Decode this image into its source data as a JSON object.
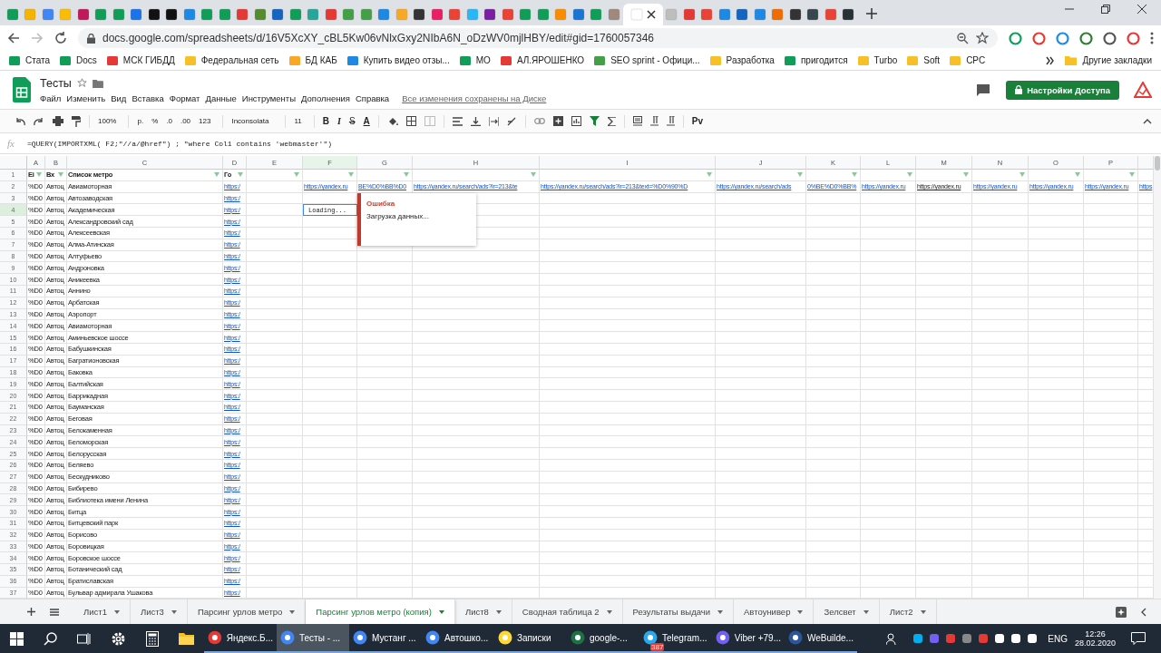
{
  "browser": {
    "url": "docs.google.com/spreadsheets/d/16V5XcXY_cBL5Kw06vNlxGxy2NIbA6N_oDzWV0mjlHBY/edit#gid=1760057346",
    "bookmarks": [
      {
        "label": "Стата"
      },
      {
        "label": "Docs"
      },
      {
        "label": "МСК ГИБДД"
      },
      {
        "label": "Федеральная сеть"
      },
      {
        "label": "БД КАБ"
      },
      {
        "label": "Купить видео отзы..."
      },
      {
        "label": "МО"
      },
      {
        "label": "АЛ.ЯРОШЕНКО"
      },
      {
        "label": "SEO sprint - Офици..."
      },
      {
        "label": "Разработка"
      },
      {
        "label": "пригодится"
      },
      {
        "label": "Turbo"
      },
      {
        "label": "Soft"
      },
      {
        "label": "CPC"
      }
    ],
    "other_bookmarks": "Другие закладки"
  },
  "doc": {
    "title": "Тесты",
    "menu": [
      "Файл",
      "Изменить",
      "Вид",
      "Вставка",
      "Формат",
      "Данные",
      "Инструменты",
      "Дополнения",
      "Справка"
    ],
    "saved_status": "Все изменения сохранены на Диске",
    "share_button": "Настройки Доступа"
  },
  "toolbar": {
    "zoom": "100%",
    "currency": "р.",
    "percent": "%",
    "dec_less": ".0",
    "dec_more": ".00",
    "number_format": "123",
    "font": "Inconsolata",
    "size": "11",
    "format_letters": [
      "B",
      "I",
      "S",
      "A"
    ],
    "input_tools": "Рv"
  },
  "formula": {
    "fx": "fx",
    "text": "=QUERY(IMPORTXML( F2;\"//a/@href\") ; \"where Col1 contains 'webmaster'\")"
  },
  "columns": [
    {
      "letter": "A",
      "header": "Ei",
      "selected": false
    },
    {
      "letter": "B",
      "header": "Вх",
      "selected": false
    },
    {
      "letter": "C",
      "header": "Список метро",
      "selected": false
    },
    {
      "letter": "D",
      "header": "Го",
      "selected": false
    },
    {
      "letter": "E",
      "selected": false
    },
    {
      "letter": "F",
      "selected": true
    },
    {
      "letter": "G",
      "selected": false
    },
    {
      "letter": "H",
      "selected": false
    },
    {
      "letter": "I",
      "selected": false
    },
    {
      "letter": "J",
      "selected": false
    },
    {
      "letter": "K",
      "selected": false
    },
    {
      "letter": "L",
      "selected": false
    },
    {
      "letter": "M",
      "selected": false
    },
    {
      "letter": "N",
      "selected": false
    },
    {
      "letter": "O",
      "selected": false
    },
    {
      "letter": "P",
      "selected": false
    }
  ],
  "header_row": "1",
  "rows": [
    {
      "n": "2",
      "a": "%D0",
      "b": "Автоц",
      "c": "Авиамоторная",
      "d": "https:/",
      "selected": false,
      "more": [
        {
          "kind": "empty"
        },
        {
          "kind": "link",
          "text": "https://yandex.ru"
        },
        {
          "kind": "link",
          "text": "BE%D0%BB%D0"
        },
        {
          "kind": "link",
          "text": "https://yandex.ru/search/ads?lr=213&te"
        },
        {
          "kind": "link",
          "text": "https://yandex.ru/search/ads?lr=213&text=%D0%90%D"
        },
        {
          "kind": "link",
          "text": "https://yandex.ru/search/ads"
        },
        {
          "kind": "link",
          "text": "0%BE%D0%BB%"
        },
        {
          "kind": "link",
          "text": "https://yandex.ru"
        },
        {
          "kind": "dark",
          "text": "https://yandex.ru"
        },
        {
          "kind": "link",
          "text": "https://yandex.ru"
        },
        {
          "kind": "link",
          "text": "https://yandex.ru"
        },
        {
          "kind": "link",
          "text": "https://yandex.ru"
        },
        {
          "kind": "link",
          "text": "https"
        }
      ]
    },
    {
      "n": "3",
      "a": "%D0",
      "b": "Автоц",
      "c": "Автозаводская",
      "d": "https:/",
      "selected": false
    },
    {
      "n": "4",
      "a": "%D0",
      "b": "Автоц",
      "c": "Академическая",
      "d": "https:/",
      "selected": true,
      "more": [
        {
          "kind": "empty"
        },
        {
          "kind": "loading",
          "text": "Loading..."
        }
      ]
    },
    {
      "n": "5",
      "a": "%D0",
      "b": "Автоц",
      "c": "Александровский сад",
      "d": "https:/",
      "selected": false
    },
    {
      "n": "6",
      "a": "%D0",
      "b": "Автоц",
      "c": "Алексеевская",
      "d": "https:/",
      "selected": false
    },
    {
      "n": "7",
      "a": "%D0",
      "b": "Автоц",
      "c": "Алма-Атинская",
      "d": "https:/",
      "selected": false
    },
    {
      "n": "8",
      "a": "%D0",
      "b": "Автоц",
      "c": "Алтуфьево",
      "d": "https:/",
      "selected": false
    },
    {
      "n": "9",
      "a": "%D0",
      "b": "Автоц",
      "c": "Андроновка",
      "d": "https:/",
      "selected": false
    },
    {
      "n": "10",
      "a": "%D0",
      "b": "Автоц",
      "c": "Аникеевка",
      "d": "https:/",
      "selected": false
    },
    {
      "n": "11",
      "a": "%D0",
      "b": "Автоц",
      "c": "Аннино",
      "d": "https:/",
      "selected": false
    },
    {
      "n": "12",
      "a": "%D0",
      "b": "Автоц",
      "c": "Арбатская",
      "d": "https:/",
      "selected": false
    },
    {
      "n": "13",
      "a": "%D0",
      "b": "Автоц",
      "c": "Аэропорт",
      "d": "https:/",
      "selected": false
    },
    {
      "n": "14",
      "a": "%D0",
      "b": "Автоц",
      "c": "Авиамоторная",
      "d": "https:/",
      "selected": false
    },
    {
      "n": "15",
      "a": "%D0",
      "b": "Автоц",
      "c": "Аминьевское шоссе",
      "d": "https:/",
      "selected": false
    },
    {
      "n": "16",
      "a": "%D0",
      "b": "Автоц",
      "c": "Бабушкинская",
      "d": "https:/",
      "selected": false
    },
    {
      "n": "17",
      "a": "%D0",
      "b": "Автоц",
      "c": "Багратионовская",
      "d": "https:/",
      "selected": false
    },
    {
      "n": "18",
      "a": "%D0",
      "b": "Автоц",
      "c": "Баковка",
      "d": "https:/",
      "selected": false
    },
    {
      "n": "19",
      "a": "%D0",
      "b": "Автоц",
      "c": "Балтийская",
      "d": "https:/",
      "selected": false
    },
    {
      "n": "20",
      "a": "%D0",
      "b": "Автоц",
      "c": "Баррикадная",
      "d": "https:/",
      "selected": false
    },
    {
      "n": "21",
      "a": "%D0",
      "b": "Автоц",
      "c": "Бауманская",
      "d": "https:/",
      "selected": false
    },
    {
      "n": "22",
      "a": "%D0",
      "b": "Автоц",
      "c": "Беговая",
      "d": "https:/",
      "selected": false
    },
    {
      "n": "23",
      "a": "%D0",
      "b": "Автоц",
      "c": "Белокаменная",
      "d": "https:/",
      "selected": false
    },
    {
      "n": "24",
      "a": "%D0",
      "b": "Автоц",
      "c": "Беломорская",
      "d": "https:/",
      "selected": false
    },
    {
      "n": "25",
      "a": "%D0",
      "b": "Автоц",
      "c": "Белорусская",
      "d": "https:/",
      "selected": false
    },
    {
      "n": "26",
      "a": "%D0",
      "b": "Автоц",
      "c": "Беляево",
      "d": "https:/",
      "selected": false
    },
    {
      "n": "27",
      "a": "%D0",
      "b": "Автоц",
      "c": "Бескудниково",
      "d": "https:/",
      "selected": false
    },
    {
      "n": "28",
      "a": "%D0",
      "b": "Автоц",
      "c": "Бибирево",
      "d": "https:/",
      "selected": false
    },
    {
      "n": "29",
      "a": "%D0",
      "b": "Автоц",
      "c": "Библиотека имени Ленина",
      "d": "https:/",
      "selected": false
    },
    {
      "n": "30",
      "a": "%D0",
      "b": "Автоц",
      "c": "Битца",
      "d": "https:/",
      "selected": false
    },
    {
      "n": "31",
      "a": "%D0",
      "b": "Автоц",
      "c": "Битцевский парк",
      "d": "https:/",
      "selected": false
    },
    {
      "n": "32",
      "a": "%D0",
      "b": "Автоц",
      "c": "Борисово",
      "d": "https:/",
      "selected": false
    },
    {
      "n": "33",
      "a": "%D0",
      "b": "Автоц",
      "c": "Боровицкая",
      "d": "https:/",
      "selected": false
    },
    {
      "n": "34",
      "a": "%D0",
      "b": "Автоц",
      "c": "Боровское шоссе",
      "d": "https:/",
      "selected": false
    },
    {
      "n": "35",
      "a": "%D0",
      "b": "Автоц",
      "c": "Ботанический сад",
      "d": "https:/",
      "selected": false
    },
    {
      "n": "36",
      "a": "%D0",
      "b": "Автоц",
      "c": "Братиславская",
      "d": "https:/",
      "selected": false
    },
    {
      "n": "37",
      "a": "%D0",
      "b": "Автоц",
      "c": "Бульвар адмирала Ушакова",
      "d": "https:/",
      "selected": false
    }
  ],
  "tooltip": {
    "title": "Ошибка",
    "text": "Загрузка данных..."
  },
  "sheet_tabs": [
    {
      "label": "Лист1",
      "selected": false
    },
    {
      "label": "Лист3",
      "selected": false
    },
    {
      "label": "Парсинг урлов метро",
      "selected": false
    },
    {
      "label": "Парсинг урлов метро (копия)",
      "selected": true
    },
    {
      "label": "Лист8",
      "selected": false
    },
    {
      "label": "Сводная таблица 2",
      "selected": false
    },
    {
      "label": "Результаты выдачи",
      "selected": false
    },
    {
      "label": "Автоунивер",
      "selected": false
    },
    {
      "label": "Зелсвет",
      "selected": false
    },
    {
      "label": "Лист2",
      "selected": false
    }
  ],
  "taskbar": {
    "apps": [
      {
        "label": "Яндекс.Б...",
        "selected": false
      },
      {
        "label": "Тесты - ...",
        "selected": true
      },
      {
        "label": "Мустанг ...",
        "selected": false
      },
      {
        "label": "Автошко...",
        "selected": false
      },
      {
        "label": "Записки",
        "selected": false
      },
      {
        "label": "google-...",
        "selected": false
      },
      {
        "label": "Telegram...",
        "selected": false,
        "badge": "387"
      },
      {
        "label": "Viber +79...",
        "selected": false
      },
      {
        "label": "WeBuilde...",
        "selected": false
      }
    ],
    "lang": "ENG",
    "time": "12:26",
    "date": "28.02.2020"
  }
}
